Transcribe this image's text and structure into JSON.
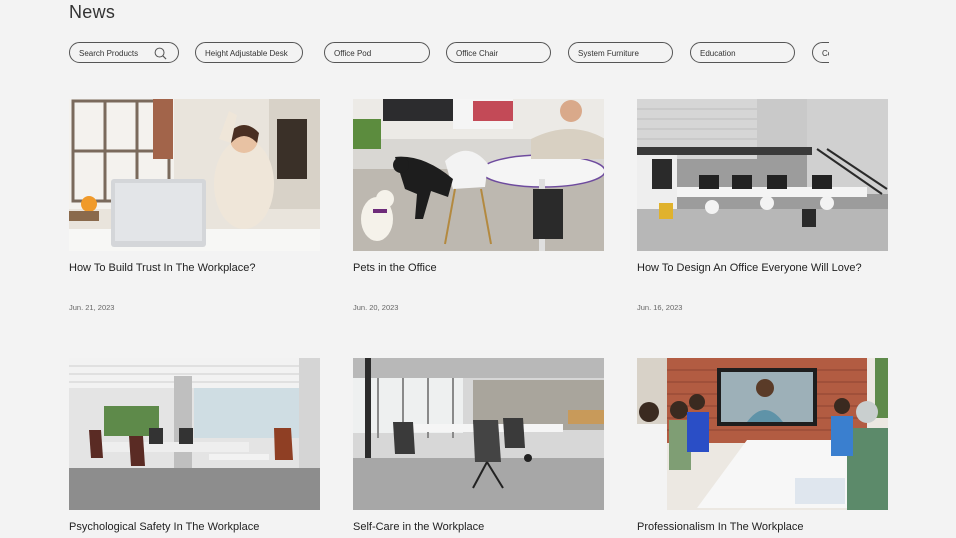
{
  "page": {
    "title": "News"
  },
  "search": {
    "placeholder": "Search Products",
    "icon": "search-icon"
  },
  "filters": [
    "Height Adjustable Desk",
    "Office Pod",
    "Office Chair",
    "System Furniture",
    "Education",
    "Co"
  ],
  "articles": [
    {
      "title": "How To Build Trust In The Workplace?",
      "date": "Jun. 21, 2023"
    },
    {
      "title": "Pets in the Office",
      "date": "Jun. 20, 2023"
    },
    {
      "title": "How To Design An Office Everyone Will Love?",
      "date": "Jun. 16, 2023"
    },
    {
      "title": "Psychological Safety In The Workplace",
      "date": ""
    },
    {
      "title": "Self-Care in the Workplace",
      "date": ""
    },
    {
      "title": "Professionalism In The Workplace",
      "date": ""
    }
  ],
  "colors": {
    "background": "#f3f3f3",
    "text": "#2b2b2b",
    "pill_border": "#555555"
  }
}
